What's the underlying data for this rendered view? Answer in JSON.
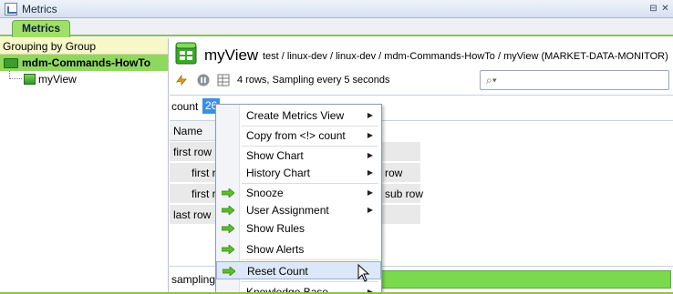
{
  "window": {
    "title": "Metrics",
    "tab": "Metrics"
  },
  "tree": {
    "group_header": "Grouping by Group",
    "root": "mdm-Commands-HowTo",
    "child": "myView"
  },
  "view": {
    "title": "myView",
    "path": "test / linux-dev / linux-dev / mdm-Commands-HowTo / myView (MARKET-DATA-MONITOR)",
    "status": "4 rows, Sampling every 5 seconds",
    "search_placeholder": ""
  },
  "count": {
    "label": "count",
    "value": "26"
  },
  "grid": {
    "column_header": "Name",
    "rows": [
      {
        "left": "first row",
        "right": ""
      },
      {
        "left": "first r",
        "right": "row"
      },
      {
        "left": "first r",
        "right": "sub row"
      },
      {
        "left": "last row",
        "right": ""
      }
    ]
  },
  "sampling": {
    "label": "samplingS"
  },
  "menu": {
    "items": [
      "Create Metrics View",
      "Copy from <!> count",
      "Show Chart",
      "History Chart",
      "Snooze",
      "User Assignment",
      "Show Rules",
      "Show Alerts",
      "Reset Count",
      "Knowledge Base"
    ]
  },
  "colors": {
    "accent_green": "#7bd94e",
    "selection_blue": "#3d8fe0",
    "menu_highlight": "#dce8f7"
  }
}
